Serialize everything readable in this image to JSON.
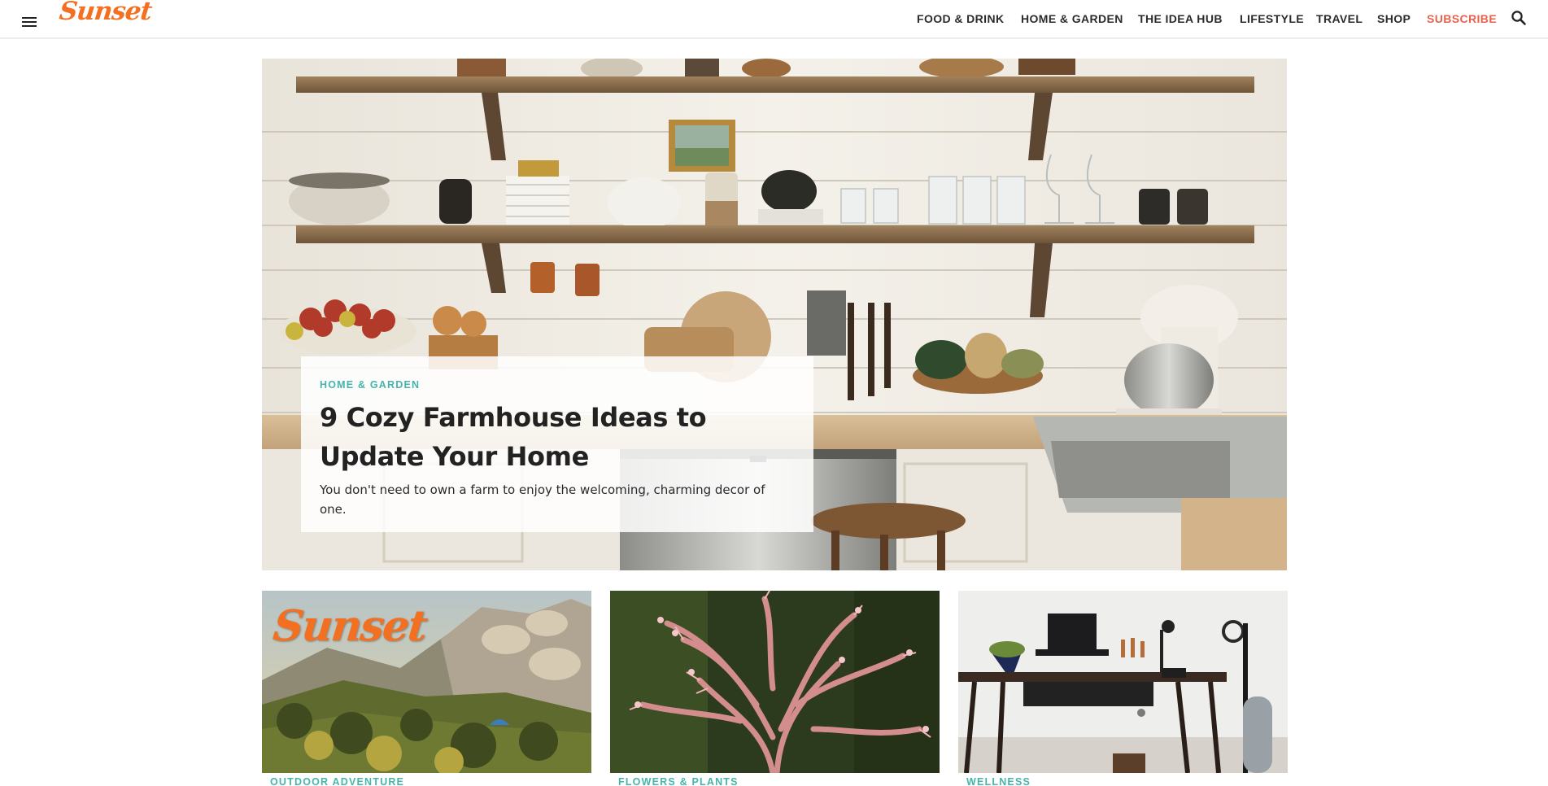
{
  "brand": {
    "logo_text": "Sunset",
    "accent_color": "#f36f21"
  },
  "header": {
    "menu_icon": "hamburger-menu-icon",
    "nav": [
      {
        "label": "FOOD & DRINK"
      },
      {
        "label": "HOME & GARDEN"
      },
      {
        "label": "THE IDEA HUB"
      },
      {
        "label": "LIFESTYLE"
      },
      {
        "label": "TRAVEL"
      },
      {
        "label": "SHOP"
      },
      {
        "label": "SUBSCRIBE",
        "color": "#e8624c"
      }
    ],
    "search_icon": "search-icon"
  },
  "hero": {
    "category": "HOME & GARDEN",
    "title": "9 Cozy Farmhouse Ideas to Update Your Home",
    "description": "You don't need to own a farm to enjoy the welcoming, charming decor of one.",
    "category_color": "#45b5ac"
  },
  "cards": [
    {
      "category": "OUTDOOR ADVENTURE",
      "image_logo": "Sunset"
    },
    {
      "category": "FLOWERS & PLANTS"
    },
    {
      "category": "WELLNESS"
    }
  ]
}
